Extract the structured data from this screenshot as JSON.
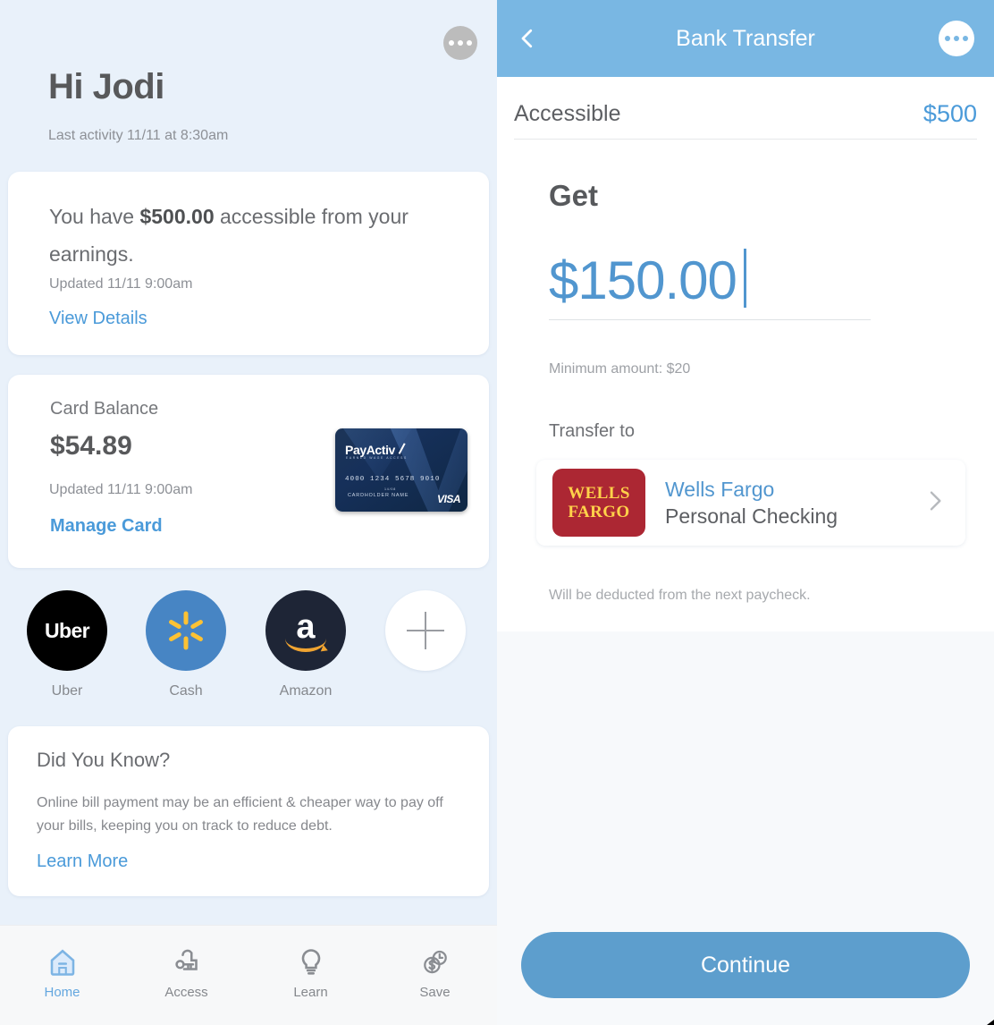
{
  "left": {
    "more_icon": "more-horizontal-icon",
    "greeting": "Hi Jodi",
    "last_activity": "Last activity 11/11 at 8:30am",
    "earnings_card": {
      "text_before": "You have ",
      "amount": "$500.00",
      "text_after": " accessible from your earnings.",
      "updated": "Updated 11/11 9:00am",
      "link": "View Details"
    },
    "balance_card": {
      "label": "Card Balance",
      "amount": "$54.89",
      "updated": "Updated 11/11 9:00am",
      "link": "Manage Card",
      "credit_card": {
        "brand": "PayActiv",
        "tagline": "EARNED WAGE ACCESS",
        "number": "4000 1234 5678 9010",
        "expiry": "14/08",
        "holder": "CARDHOLDER NAME",
        "network": "VISA"
      }
    },
    "shortcuts": [
      {
        "label": "Uber",
        "icon": "uber-icon",
        "wordmark": "Uber"
      },
      {
        "label": "Cash",
        "icon": "walmart-spark-icon"
      },
      {
        "label": "Amazon",
        "icon": "amazon-icon",
        "wordmark": "a"
      },
      {
        "label": "",
        "icon": "plus-icon"
      }
    ],
    "did_you_know": {
      "title": "Did You Know?",
      "body": "Online bill payment may be an efficient & cheaper way to pay off your bills, keeping you on track to reduce debt.",
      "link": "Learn More"
    },
    "nav": [
      {
        "label": "Home",
        "icon": "home-icon",
        "active": true
      },
      {
        "label": "Access",
        "icon": "key-icon",
        "active": false
      },
      {
        "label": "Learn",
        "icon": "lightbulb-icon",
        "active": false
      },
      {
        "label": "Save",
        "icon": "savings-clock-icon",
        "active": false
      }
    ]
  },
  "right": {
    "header": {
      "back_icon": "chevron-left-icon",
      "title": "Bank Transfer",
      "more_icon": "more-horizontal-icon"
    },
    "accessible": {
      "label": "Accessible",
      "value": "$500"
    },
    "get": {
      "label": "Get",
      "amount": "$150.00",
      "min_note": "Minimum amount: $20"
    },
    "transfer_to": {
      "label": "Transfer to",
      "bank_logo_line1": "WELLS",
      "bank_logo_line2": "FARGO",
      "bank_name": "Wells Fargo",
      "account_type": "Personal Checking",
      "chevron_icon": "chevron-right-icon"
    },
    "deduct_note": "Will be deducted from the next paycheck.",
    "continue_label": "Continue"
  },
  "colors": {
    "accent_blue": "#4a9ad9",
    "header_blue": "#79b7e3",
    "button_blue": "#5d9ecd",
    "left_bg": "#e9f1fa",
    "wells_fargo_red": "#ac2733",
    "wells_fargo_gold": "#ffd24a"
  }
}
